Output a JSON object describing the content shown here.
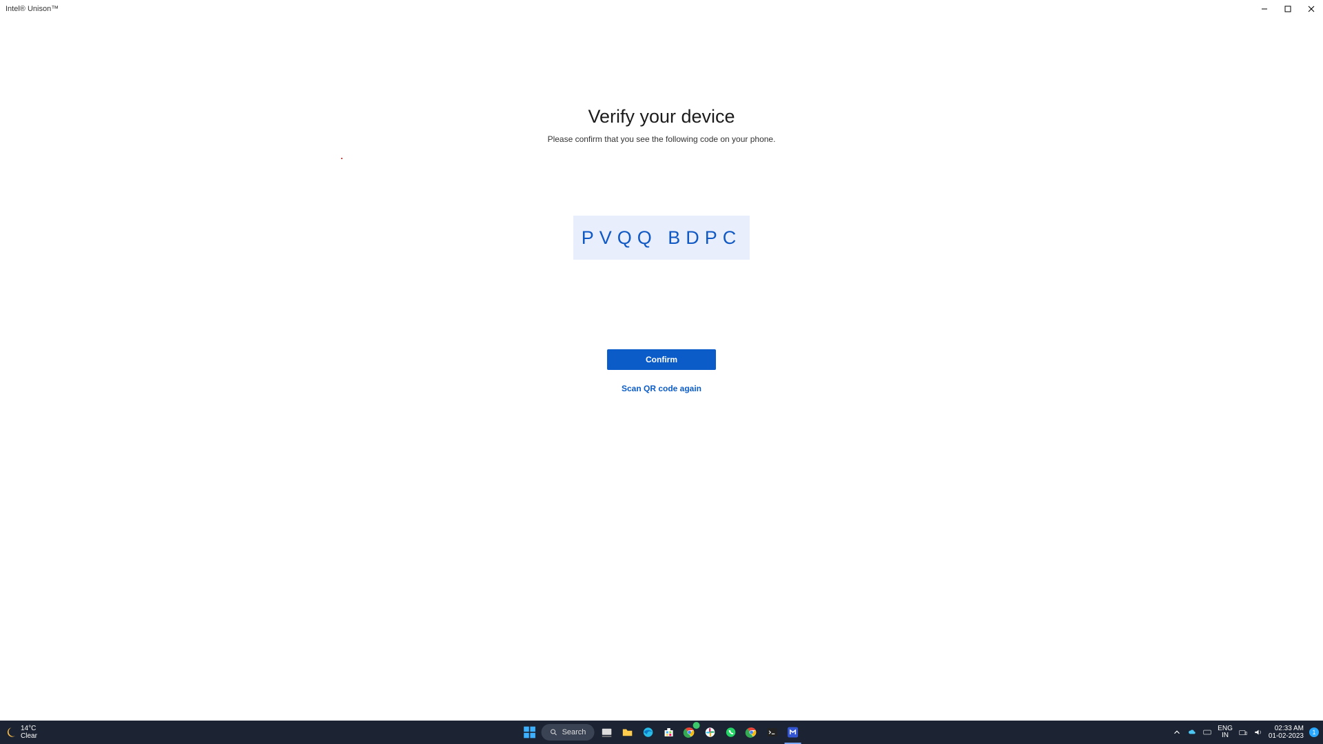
{
  "window": {
    "title": "Intel® Unison™"
  },
  "main": {
    "heading": "Verify your device",
    "subtext": "Please confirm that you see the following code on your phone.",
    "code": "PVQQ BDPC",
    "confirm": "Confirm",
    "scan_again": "Scan QR code again"
  },
  "taskbar": {
    "weather": {
      "temp": "14°C",
      "cond": "Clear"
    },
    "search": "Search",
    "lang": {
      "a": "ENG",
      "b": "IN"
    },
    "clock": {
      "time": "02:33 AM",
      "date": "01-02-2023"
    },
    "notif": "1"
  }
}
